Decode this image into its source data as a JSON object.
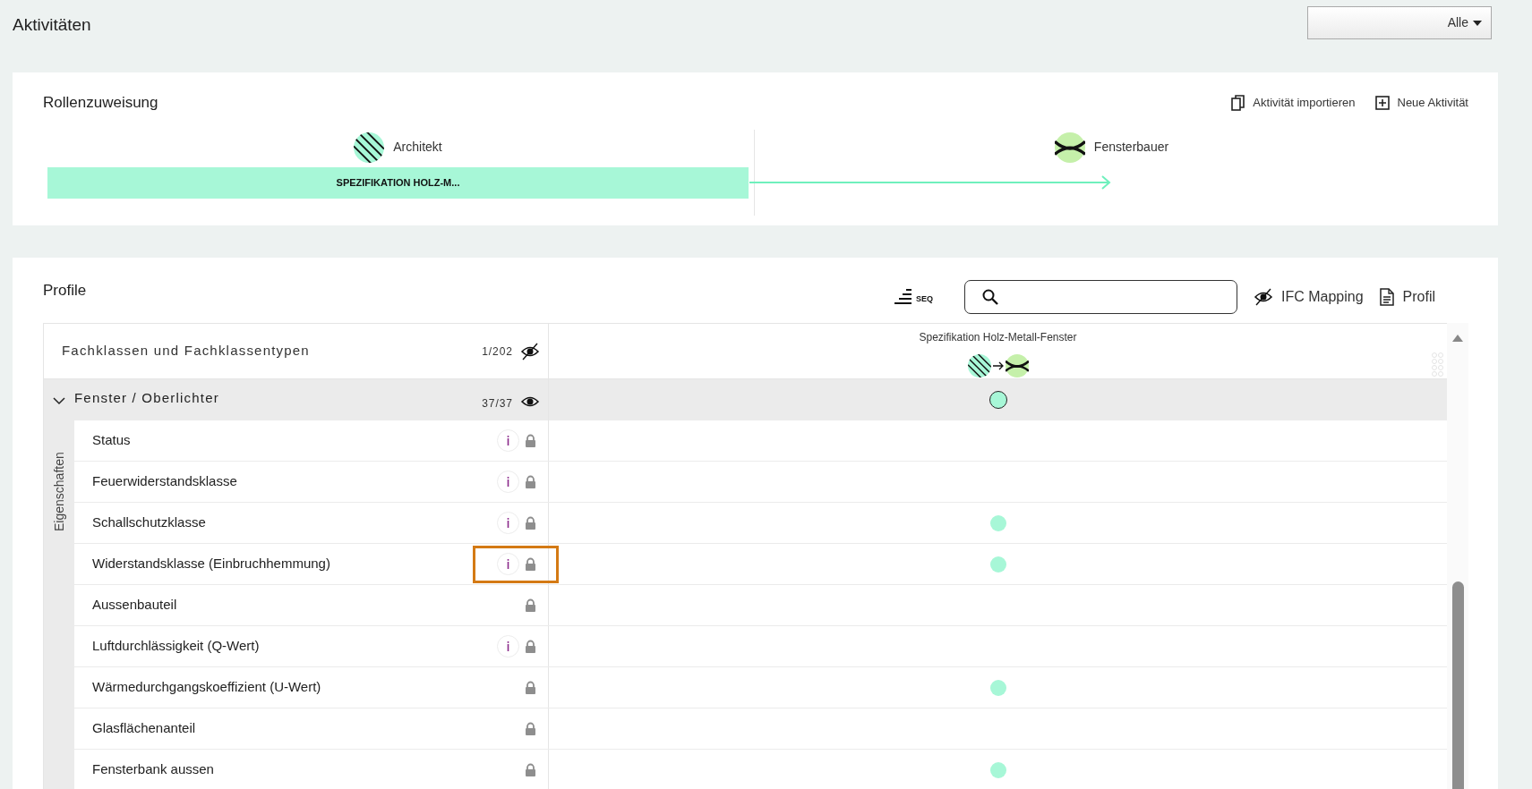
{
  "page_title": "Aktivitäten",
  "filter": {
    "value": "Alle"
  },
  "roles_card": {
    "title": "Rollenzuweisung",
    "actions": [
      {
        "kind": "import",
        "label": "Aktivität importieren"
      },
      {
        "kind": "new",
        "label": "Neue Aktivität"
      }
    ],
    "roles": [
      {
        "kind": "architect",
        "name": "Architekt"
      },
      {
        "kind": "window_maker",
        "name": "Fensterbauer"
      }
    ],
    "activity": {
      "label": "SPEZIFIKATION HOLZ-M..."
    }
  },
  "profiles_card": {
    "title": "Profile",
    "seq_label": "SEQ",
    "ifc_mapping": {
      "label": "IFC Mapping",
      "visible": false
    },
    "profile_button": {
      "label": "Profil"
    },
    "header": {
      "label": "Fachklassen und Fachklassentypen",
      "count": "1/202",
      "visible": false,
      "column_title": "Spezifikation Holz-Metall-Fenster",
      "column_roles": [
        {
          "kind": "architect"
        },
        {
          "kind": "window_maker"
        }
      ]
    },
    "group": {
      "label": "Fenster / Oberlichter",
      "count": "37/37",
      "visible": true,
      "expanded": true,
      "assigned": true
    },
    "section_label": "Eigenschaften",
    "rows": [
      {
        "label": "Status",
        "info": true,
        "assigned": false,
        "highlighted": false
      },
      {
        "label": "Feuerwiderstandsklasse",
        "info": true,
        "assigned": false,
        "highlighted": false
      },
      {
        "label": "Schallschutzklasse",
        "info": true,
        "assigned": true,
        "highlighted": false
      },
      {
        "label": "Widerstandsklasse (Einbruchhemmung)",
        "info": true,
        "assigned": true,
        "highlighted": true
      },
      {
        "label": "Aussenbauteil",
        "info": false,
        "assigned": false,
        "highlighted": false
      },
      {
        "label": "Luftdurchlässigkeit (Q-Wert)",
        "info": true,
        "assigned": false,
        "highlighted": false
      },
      {
        "label": "Wärmedurchgangskoeffizient (U-Wert)",
        "info": false,
        "assigned": true,
        "highlighted": false
      },
      {
        "label": "Glasflächenanteil",
        "info": false,
        "assigned": false,
        "highlighted": false
      },
      {
        "label": "Fensterbank aussen",
        "info": false,
        "assigned": true,
        "highlighted": false
      }
    ]
  }
}
